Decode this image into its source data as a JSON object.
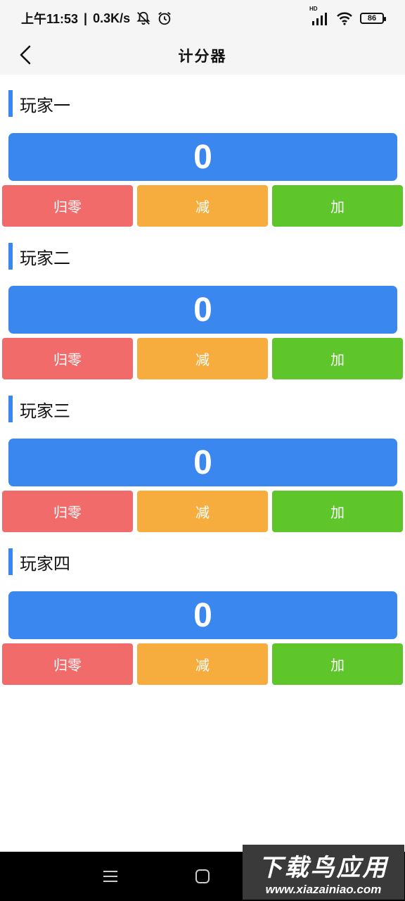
{
  "status_bar": {
    "time": "上午11:53",
    "separator": "|",
    "speed": "0.3K/s",
    "battery": "86",
    "network_label": "HD"
  },
  "header": {
    "title": "计分器"
  },
  "players": [
    {
      "name": "玩家一",
      "score": "0",
      "reset_label": "归零",
      "minus_label": "减",
      "plus_label": "加"
    },
    {
      "name": "玩家二",
      "score": "0",
      "reset_label": "归零",
      "minus_label": "减",
      "plus_label": "加"
    },
    {
      "name": "玩家三",
      "score": "0",
      "reset_label": "归零",
      "minus_label": "减",
      "plus_label": "加"
    },
    {
      "name": "玩家四",
      "score": "0",
      "reset_label": "归零",
      "minus_label": "减",
      "plus_label": "加"
    }
  ],
  "colors": {
    "accent": "#3a87f0",
    "reset": "#f26b6b",
    "minus": "#f7ad3e",
    "plus": "#5ec62a"
  },
  "watermark": {
    "title": "下载鸟应用",
    "url": "www.xiazainiao.com"
  },
  "icons": {
    "back": "chevron-left-icon",
    "mute": "bell-off-icon",
    "alarm": "alarm-icon",
    "signal": "signal-icon",
    "wifi": "wifi-icon",
    "battery": "battery-icon",
    "menu": "menu-icon",
    "home": "home-icon"
  }
}
